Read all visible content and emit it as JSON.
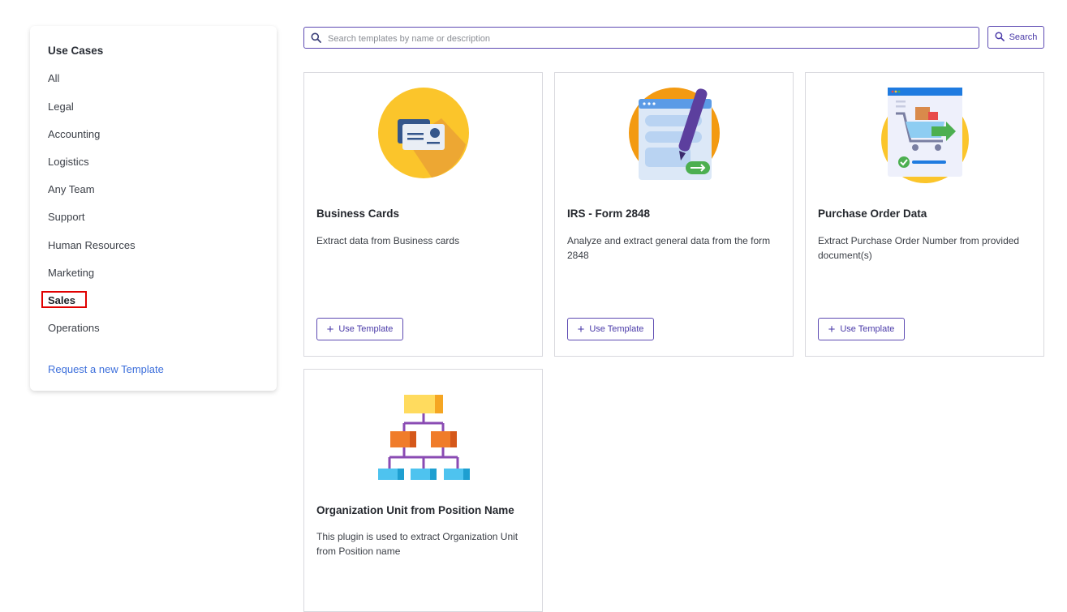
{
  "sidebar": {
    "heading": "Use Cases",
    "items": [
      {
        "label": "All"
      },
      {
        "label": "Legal"
      },
      {
        "label": "Accounting"
      },
      {
        "label": "Logistics"
      },
      {
        "label": "Any Team"
      },
      {
        "label": "Support"
      },
      {
        "label": "Human Resources"
      },
      {
        "label": "Marketing"
      },
      {
        "label": "Sales"
      },
      {
        "label": "Operations"
      }
    ],
    "active_item": "Sales",
    "request_link": "Request a new Template"
  },
  "search": {
    "placeholder": "Search templates by name or description",
    "button_label": "Search"
  },
  "templates": [
    {
      "title": "Business Cards",
      "description": "Extract data from Business cards",
      "button_label": "Use Template",
      "icon": "business-card-icon"
    },
    {
      "title": "IRS - Form 2848",
      "description": "Analyze and extract general data from the form 2848",
      "button_label": "Use Template",
      "icon": "form-pen-icon"
    },
    {
      "title": "Purchase Order Data",
      "description": "Extract Purchase Order Number from provided document(s)",
      "button_label": "Use Template",
      "icon": "shopping-cart-icon"
    },
    {
      "title": "Organization Unit from Position Name",
      "description": "This plugin is used to extract Organization Unit from Position name",
      "button_label": "Use Template",
      "icon": "org-chart-icon"
    }
  ],
  "colors": {
    "accent": "#5d4ab2",
    "link": "#3d6fdb",
    "active_outline": "#e00000",
    "yellow": "#fbc52b",
    "orange": "#f39a11"
  }
}
